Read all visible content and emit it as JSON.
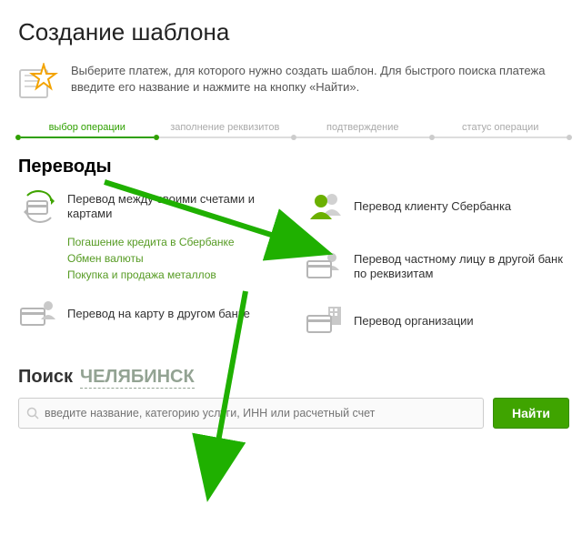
{
  "title": "Создание шаблона",
  "info": "Выберите платеж, для которого нужно создать шаблон. Для быстрого поиска платежа введите его название и нажмите на кнопку «Найти».",
  "stepper": [
    "выбор операции",
    "заполнение реквизитов",
    "подтверждение",
    "статус операции"
  ],
  "transfers": {
    "heading": "Переводы",
    "left": [
      {
        "label": "Перевод между своими счетами и картами"
      },
      {
        "sublinks": [
          "Погашение кредита в Сбербанке",
          "Обмен валюты",
          "Покупка и продажа металлов"
        ]
      },
      {
        "label": "Перевод на карту в другом банке"
      }
    ],
    "right": [
      {
        "label": "Перевод клиенту Сбербанка"
      },
      {
        "label": "Перевод частному лицу в другой банк по реквизитам"
      },
      {
        "label": "Перевод организации"
      }
    ]
  },
  "search": {
    "title": "Поиск",
    "region": "ЧЕЛЯБИНСК",
    "placeholder": "введите название, категорию услуги, ИНН или расчетный счет",
    "button": "Найти"
  }
}
